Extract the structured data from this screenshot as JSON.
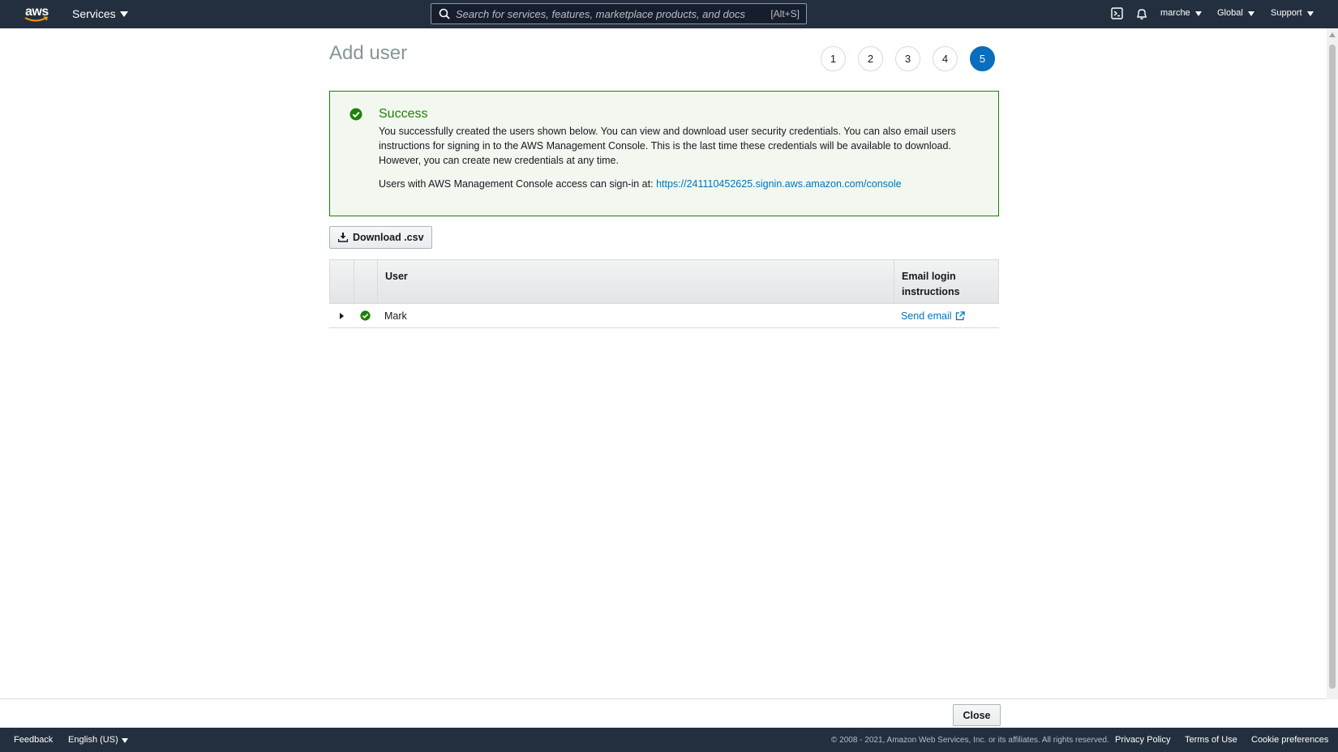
{
  "topnav": {
    "logo_text": "aws",
    "services_label": "Services",
    "search_placeholder": "Search for services, features, marketplace products, and docs",
    "search_shortcut": "[Alt+S]",
    "account_label": "marche",
    "region_label": "Global",
    "support_label": "Support"
  },
  "page": {
    "title": "Add user",
    "steps": [
      "1",
      "2",
      "3",
      "4",
      "5"
    ],
    "active_step": 5
  },
  "alert": {
    "title": "Success",
    "body": "You successfully created the users shown below. You can view and download user security credentials. You can also email users instructions for signing in to the AWS Management Console. This is the last time these credentials will be available to download. However, you can create new credentials at any time.",
    "signin_prefix": "Users with AWS Management Console access can sign-in at: ",
    "signin_url": "https://241110452625.signin.aws.amazon.com/console"
  },
  "download_button": "Download .csv",
  "table": {
    "headers": [
      "",
      "",
      "User",
      "Email login instructions"
    ],
    "rows": [
      {
        "user": "Mark",
        "email_action": "Send email"
      }
    ]
  },
  "close_button": "Close",
  "footer": {
    "feedback": "Feedback",
    "language": "English (US)",
    "copyright": "© 2008 - 2021, Amazon Web Services, Inc. or its affiliates. All rights reserved.",
    "privacy": "Privacy Policy",
    "terms": "Terms of Use",
    "cookies": "Cookie preferences"
  },
  "colors": {
    "nav_bg": "#232f3e",
    "success_green": "#1d8102",
    "link_blue": "#0073bb",
    "active_step": "#0b6dbd"
  }
}
